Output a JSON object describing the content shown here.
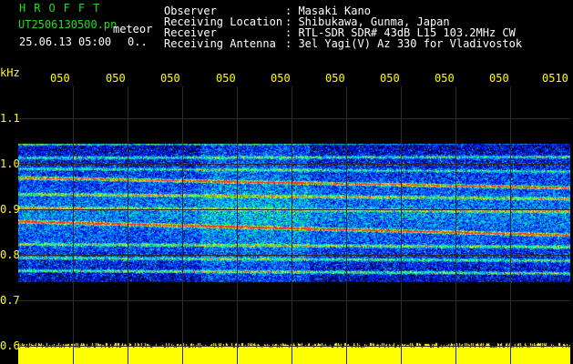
{
  "app": {
    "title": "HROFFT",
    "filename": "UT2506130500.pn",
    "mode": "meteor",
    "datetime": "25.06.13 05:00",
    "count": "0.."
  },
  "info": {
    "observer_label": "Observer",
    "observer_value": ": Masaki Kano",
    "location_label": "Receiving Location",
    "location_value": ": Shibukawa, Gunma, Japan",
    "receiver_label": "Receiver",
    "receiver_value": ": RTL-SDR SDR# 43dB L15 103.2MHz CW",
    "antenna_label": "Receiving Antenna",
    "antenna_value": ": 3el Yagi(V) Az 330 for Vladivostok"
  },
  "axis": {
    "unit": "kHz",
    "time_ticks": [
      "050",
      "050",
      "050",
      "050",
      "050",
      "050",
      "050",
      "050",
      "050",
      "0510"
    ],
    "freq_ticks": [
      "1.1",
      "1.0",
      "0.9",
      "0.8",
      "0.7",
      "0.6"
    ]
  },
  "colors": {
    "background": "#000000",
    "text": "#ffffff",
    "accent_green": "#22dd22",
    "axis_yellow": "#ffff00",
    "grid": "#2d2d2d"
  }
}
